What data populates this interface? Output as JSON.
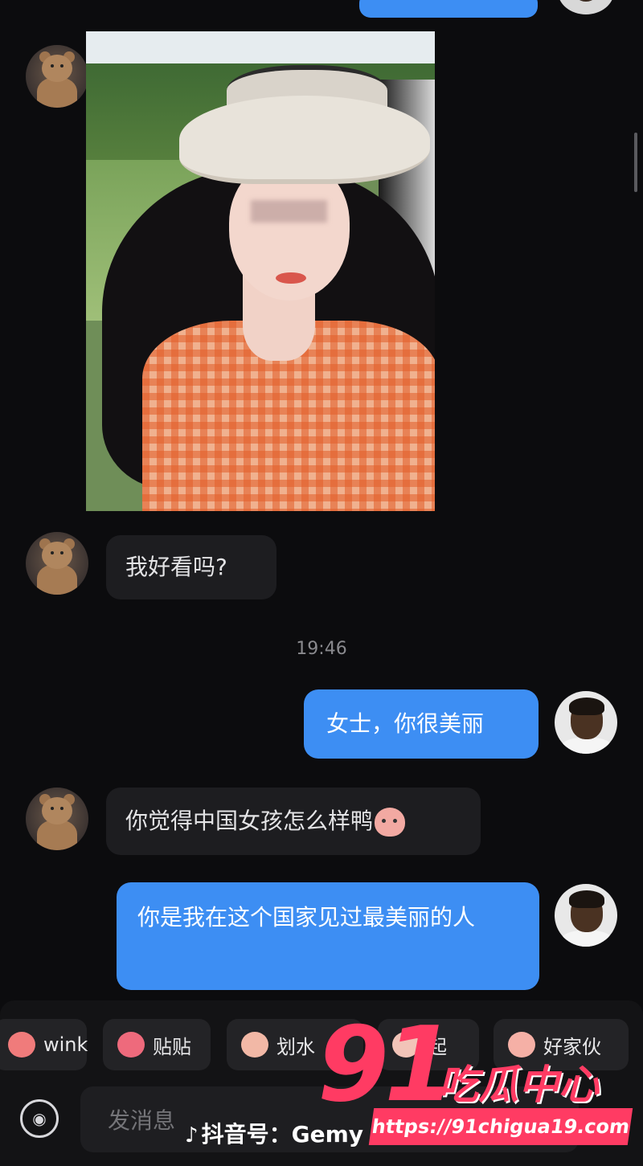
{
  "messages": [
    {
      "from": "her",
      "type": "photo"
    },
    {
      "from": "her",
      "type": "text",
      "text": "我好看吗?"
    },
    {
      "from": "me",
      "type": "text",
      "text": "女士，你很美丽"
    },
    {
      "from": "her",
      "type": "text",
      "text": "你觉得中国女孩怎么样鸭",
      "emoji": "peach-face-icon"
    },
    {
      "from": "me",
      "type": "text",
      "text": "你是我在这个国家见过最美丽的人"
    }
  ],
  "timestamp": "19:46",
  "quick_replies": [
    {
      "label": "wink",
      "icon": "wink-sticker-icon"
    },
    {
      "label": "贴贴",
      "icon": "cuddle-sticker-icon"
    },
    {
      "label": "划水",
      "icon": "paddle-sticker-icon"
    },
    {
      "label": "起",
      "icon": "sticker-icon"
    },
    {
      "label": "好家伙",
      "icon": "peach-sticker-icon"
    }
  ],
  "composer": {
    "placeholder": "发消息"
  },
  "watermark": {
    "text": "抖音号：Gemy"
  },
  "site_logo": {
    "number": "91",
    "name": "吃瓜中心",
    "url": "https://91chigua19.com"
  },
  "colors": {
    "outgoing_bubble": "#3d8ef3",
    "incoming_bubble": "#1d1d20",
    "background": "#0c0c0e",
    "logo": "#ff3b63"
  }
}
